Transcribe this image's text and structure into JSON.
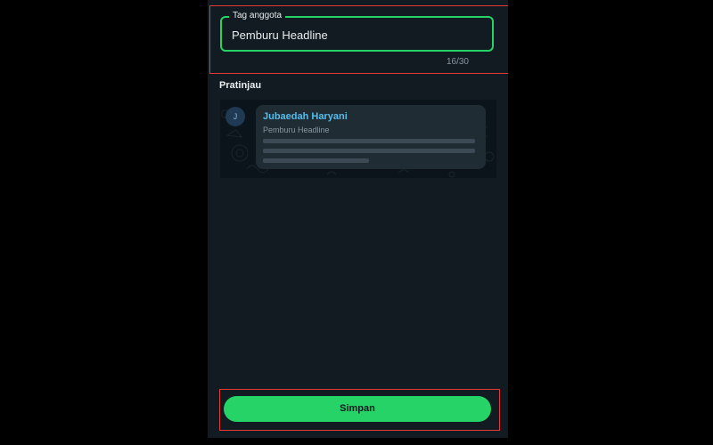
{
  "member_tag_field": {
    "legend": "Tag anggota",
    "value": "Pemburu Headline",
    "counter": "16/30"
  },
  "preview": {
    "section_title": "Pratinjau",
    "avatar_initial": "J",
    "sender_name": "Jubaedah Haryani",
    "sender_tag": "Pemburu Headline"
  },
  "actions": {
    "save_label": "Simpan"
  },
  "colors": {
    "accent": "#25d366",
    "background": "#111b21",
    "chat_background": "#0b141a",
    "bubble": "#202c33",
    "sender_name": "#53bdeb",
    "highlight_outline": "#e53935"
  }
}
